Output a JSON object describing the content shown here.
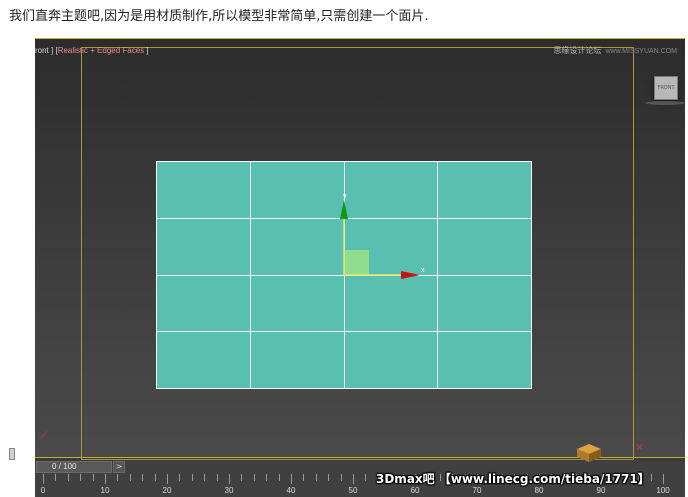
{
  "caption": "我们直奔主题吧,因为是用材质制作,所以模型非常简单,只需创建一个面片.",
  "viewport": {
    "label_prefix": "ront ] [",
    "shading_mode": "Realistic + Edged Faces",
    "label_suffix": " ]",
    "cube_face": "FRONT"
  },
  "watermark_top": {
    "text": "思缘设计论坛",
    "url": "www.MISSYUAN.COM"
  },
  "plane": {
    "color": "#58bfb1",
    "columns": 4,
    "rows": 4
  },
  "gizmo": {
    "x_label": "x",
    "y_label": "y",
    "x_color": "#cc1111",
    "y_color": "#119911",
    "plane_handle_color": "#9be08a"
  },
  "timeline": {
    "frame_display": "0 / 100",
    "next_button": ">",
    "tick_labels": [
      "0",
      "10",
      "20",
      "30",
      "40",
      "50",
      "60",
      "70",
      "80",
      "90",
      "100"
    ],
    "current_frame": 0
  },
  "watermark_bottom": "3Dmax吧 【www.linecg.com/tieba/1771】"
}
